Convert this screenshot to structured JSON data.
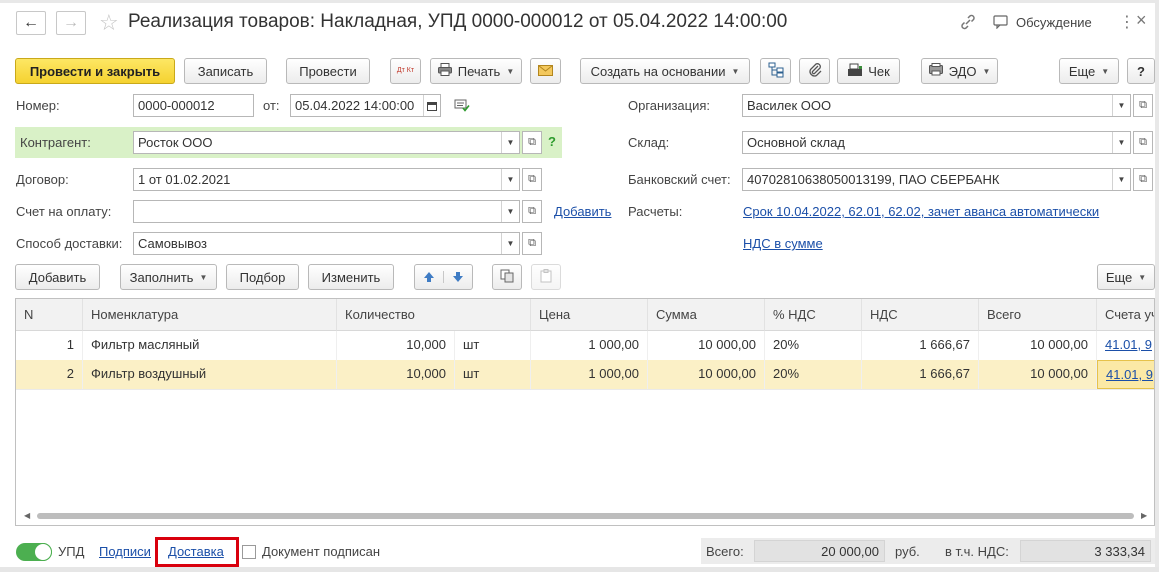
{
  "window": {
    "title": "Реализация товаров: Накладная, УПД 0000-000012 от 05.04.2022 14:00:00",
    "discussion_label": "Обсуждение"
  },
  "toolbar": {
    "post_close": "Провести и закрыть",
    "save": "Записать",
    "post": "Провести",
    "dtkt_icon_text": "Дт Кт",
    "print": "Печать",
    "create_based": "Создать на основании",
    "check": "Чек",
    "edo": "ЭДО",
    "more": "Еще",
    "help": "?"
  },
  "form": {
    "number_label": "Номер:",
    "number_value": "0000-000012",
    "date_label": "от:",
    "date_value": "05.04.2022 14:00:00",
    "org_label": "Организация:",
    "org_value": "Василек ООО",
    "counterparty_label": "Контрагент:",
    "counterparty_value": "Росток ООО",
    "question_mark": "?",
    "warehouse_label": "Склад:",
    "warehouse_value": "Основной склад",
    "contract_label": "Договор:",
    "contract_value": "1 от 01.02.2021",
    "bank_label": "Банковский счет:",
    "bank_value": "40702810638050013199, ПАО СБЕРБАНК",
    "invoice_label": "Счет на оплату:",
    "invoice_value": "",
    "add_link": "Добавить",
    "settlements_label": "Расчеты:",
    "settlements_link": "Срок 10.04.2022, 62.01, 62.02, зачет аванса автоматически",
    "delivery_label": "Способ доставки:",
    "delivery_value": "Самовывоз",
    "vat_link": "НДС в сумме"
  },
  "table_toolbar": {
    "add": "Добавить",
    "fill": "Заполнить",
    "selection": "Подбор",
    "change": "Изменить",
    "more": "Еще"
  },
  "table": {
    "columns": [
      "N",
      "Номенклатура",
      "Количество",
      "Цена",
      "Сумма",
      "% НДС",
      "НДС",
      "Всего",
      "Счета уч"
    ],
    "rows": [
      {
        "n": "1",
        "name": "Фильтр масляный",
        "qty": "10,000",
        "unit": "шт",
        "price": "1 000,00",
        "sum": "10 000,00",
        "vat_rate": "20%",
        "vat": "1 666,67",
        "total": "10 000,00",
        "accounts": "41.01, 9"
      },
      {
        "n": "2",
        "name": "Фильтр воздушный",
        "qty": "10,000",
        "unit": "шт",
        "price": "1 000,00",
        "sum": "10 000,00",
        "vat_rate": "20%",
        "vat": "1 666,67",
        "total": "10 000,00",
        "accounts": "41.01, 9"
      }
    ]
  },
  "footer": {
    "upd_label": "УПД",
    "signatures_link": "Подписи",
    "delivery_link": "Доставка",
    "signed_label": "Документ подписан",
    "total_label": "Всего:",
    "total_value": "20 000,00",
    "currency": "руб.",
    "vat_label": "в т.ч. НДС:",
    "vat_value": "3 333,34"
  },
  "colors": {
    "accent_yellow": "#f5d230",
    "link_blue": "#1b4fa8",
    "highlight_green": "#d9f1c7",
    "selected_row": "#fbf0c6",
    "red_frame": "#d9000d",
    "toggle_green": "#4caf50"
  }
}
